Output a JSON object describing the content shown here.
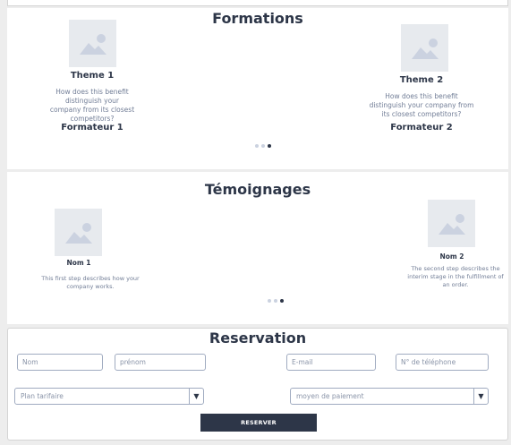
{
  "formations": {
    "title": "Formations",
    "cards": [
      {
        "theme": "Theme 1",
        "description": "How does this benefit distinguish your company from its closest competitors?",
        "trainer": "Formateur 1"
      },
      {
        "theme": "Theme 2",
        "description": "How does this benefit distinguish your company from its closest competitors?",
        "trainer": "Formateur 2"
      }
    ],
    "carousel": {
      "count": 3,
      "active": 3
    }
  },
  "temoignages": {
    "title": "Témoignages",
    "items": [
      {
        "name": "Nom 1",
        "description": "This first step describes how your company works."
      },
      {
        "name": "Nom 2",
        "description": "The second step describes the interim stage in the fulfillment of an order."
      }
    ],
    "carousel": {
      "count": 3,
      "active": 3
    }
  },
  "reservation": {
    "title": "Reservation",
    "fields": {
      "nom": {
        "placeholder": "Nom",
        "value": ""
      },
      "prenom": {
        "placeholder": "prénom",
        "value": ""
      },
      "email": {
        "placeholder": "E-mail",
        "value": ""
      },
      "telephone": {
        "placeholder": "N° de téléphone",
        "value": ""
      }
    },
    "selects": {
      "plan": {
        "selected": "Plan tarifaire",
        "arrow_icon": "triangle-down"
      },
      "paiement": {
        "selected": "moyen de paiement",
        "arrow_icon": "triangle-down"
      }
    },
    "submit_label": "RESERVER"
  },
  "colors": {
    "primary": "#2d3648",
    "muted": "#717d96",
    "placeholder_bg": "#e7eaee",
    "border": "#a0abc0"
  }
}
